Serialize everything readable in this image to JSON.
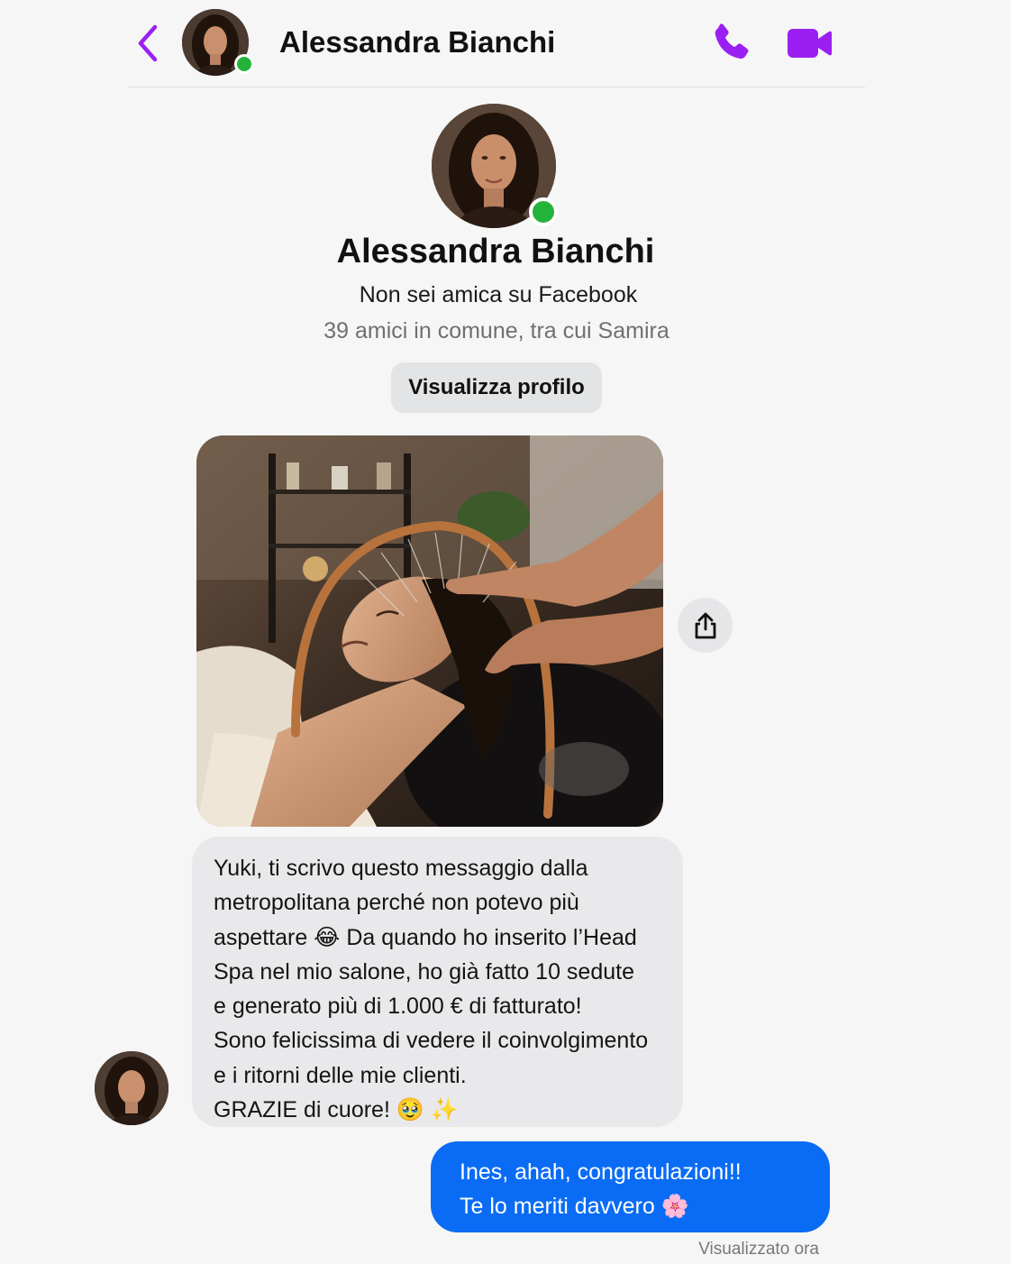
{
  "header": {
    "contact_name": "Alessandra Bianchi",
    "back_icon": "chevron-left-icon",
    "call_icon": "phone-icon",
    "video_icon": "video-camera-icon",
    "accent_color": "#9b1ff2"
  },
  "profile": {
    "name": "Alessandra Bianchi",
    "friend_status": "Non sei amica su Facebook",
    "mutual_friends": "39 amici in comune, tra cui Samira",
    "view_profile_label": "Visualizza profilo",
    "online": true
  },
  "messages": {
    "photo_share_icon": "share-icon",
    "incoming_text": "Yuki, ti scrivo questo messaggio dalla\nmetropolitana perché non potevo più\naspettare 😂 Da quando ho inserito l’Head\nSpa nel mio salone, ho già fatto 10 sedute\ne generato più di 1.000 € di fatturato!\nSono felicissima di vedere il coinvolgimento\ne i ritorni delle mie clienti.\nGRAZIE di cuore! 🥹 ✨",
    "outgoing_text": "Ines, ahah, congratulazioni!!\nTe lo meriti davvero 🌸",
    "seen_status": "Visualizzato ora",
    "outgoing_color": "#0a6cf5",
    "incoming_color": "#e9e9eb"
  }
}
